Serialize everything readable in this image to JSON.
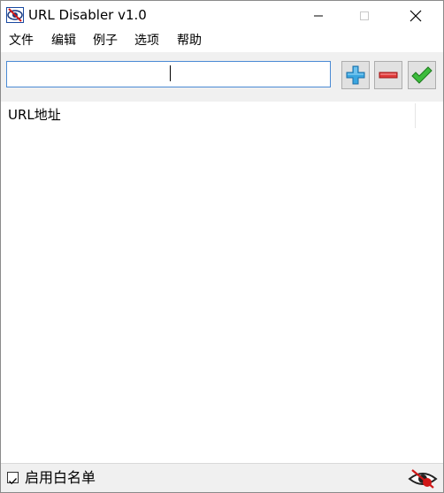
{
  "window": {
    "title": "URL Disabler v1.0",
    "icon": "app-eye-icon",
    "controls": [
      "minimize-icon",
      "maximize-icon",
      "close-icon"
    ]
  },
  "menu": {
    "items": [
      "文件",
      "编辑",
      "例子",
      "选项",
      "帮助"
    ]
  },
  "toolbar": {
    "url_input_value": "",
    "add_icon": "plus-icon",
    "remove_icon": "minus-icon",
    "apply_icon": "check-icon"
  },
  "list": {
    "columns": [
      "URL地址"
    ],
    "rows": []
  },
  "status": {
    "whitelist_label": "启用白名单",
    "whitelist_checked": true,
    "status_icon": "eye-disabled-icon"
  },
  "colors": {
    "accent_border": "#4a8ad4",
    "add_blue": "#3aa6e0",
    "remove_red": "#e03a3a",
    "apply_green": "#3cbc3c"
  }
}
